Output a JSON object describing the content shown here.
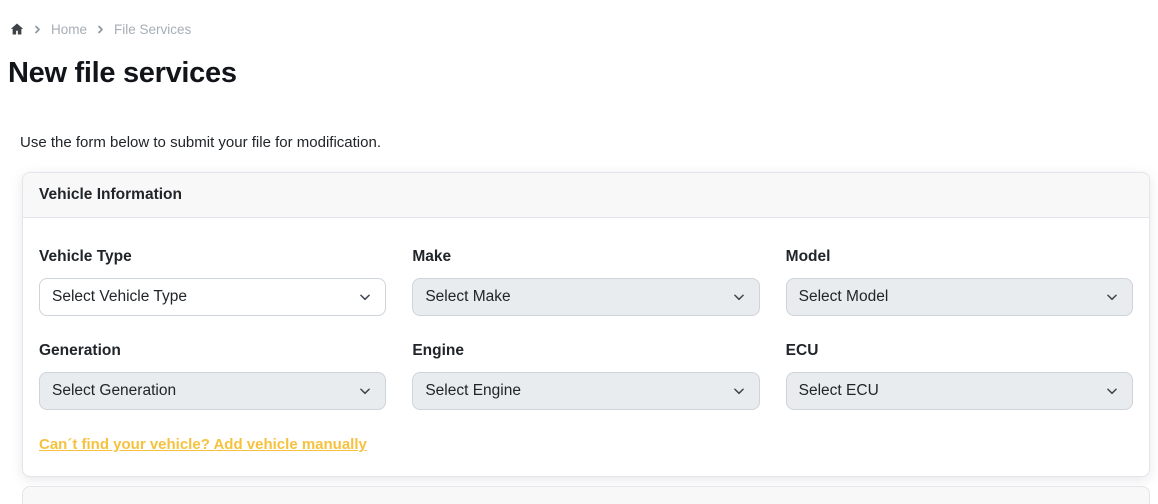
{
  "breadcrumb": {
    "items": [
      {
        "label": "Home"
      },
      {
        "label": "File Services"
      }
    ]
  },
  "page": {
    "title": "New file services",
    "intro": "Use the form below to submit your file for modification."
  },
  "vehicle_card": {
    "header": "Vehicle Information",
    "fields": [
      {
        "label": "Vehicle Type",
        "placeholder": "Select Vehicle Type",
        "disabled": false
      },
      {
        "label": "Make",
        "placeholder": "Select Make",
        "disabled": true
      },
      {
        "label": "Model",
        "placeholder": "Select Model",
        "disabled": true
      },
      {
        "label": "Generation",
        "placeholder": "Select Generation",
        "disabled": true
      },
      {
        "label": "Engine",
        "placeholder": "Select Engine",
        "disabled": true
      },
      {
        "label": "ECU",
        "placeholder": "Select ECU",
        "disabled": true
      }
    ],
    "manual_link": "Can´t find your vehicle? Add vehicle manually"
  },
  "colors": {
    "warning_link": "#f6c23e",
    "disabled_select_bg": "#e9ecef",
    "card_header_bg": "#f8f8f9",
    "border": "#e2e5e9",
    "breadcrumb_text": "#a6aeb6",
    "text": "#212529"
  }
}
